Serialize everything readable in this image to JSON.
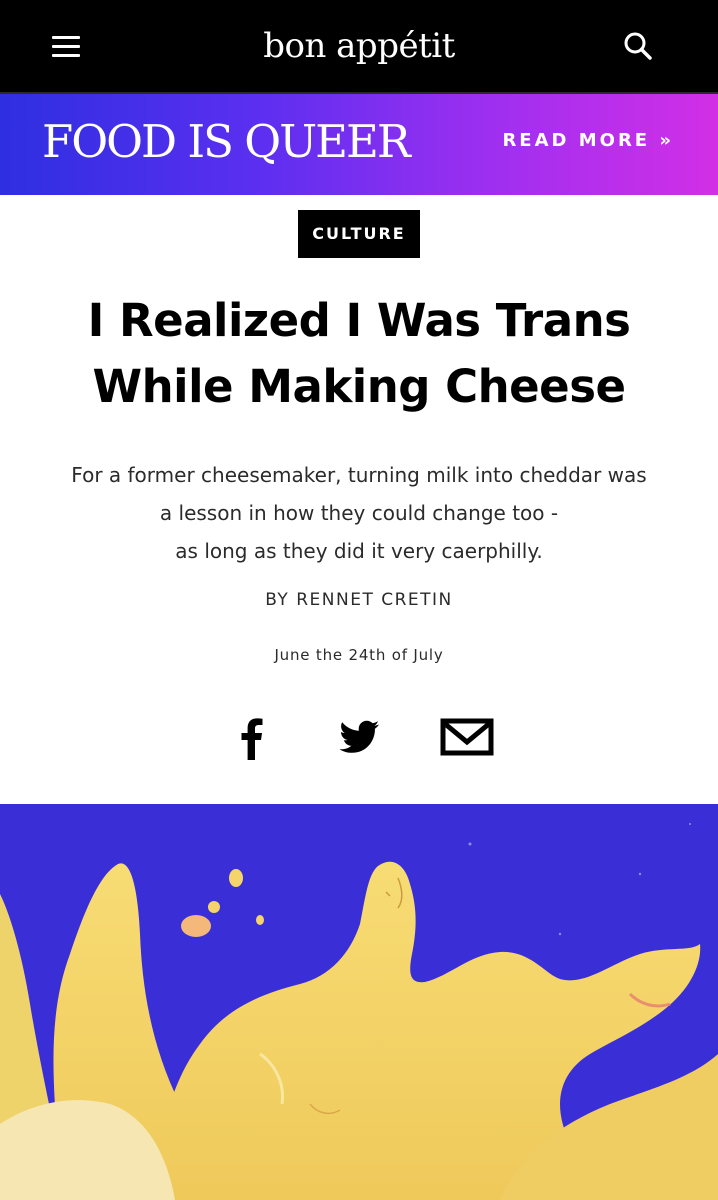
{
  "header": {
    "logo": "bon appétit",
    "menu_icon": "hamburger-menu-icon",
    "search_icon": "search-icon"
  },
  "banner": {
    "title": "FOOD IS QUEER",
    "read_more": "READ MORE »",
    "gradient": [
      "#2e2fe0",
      "#d22fe6"
    ]
  },
  "article": {
    "category": "CULTURE",
    "headline_line1": "I Realized I Was Trans",
    "headline_line2": "While Making Cheese",
    "dek_line1": "For a former cheesemaker, turning milk into cheddar was",
    "dek_line2": "a lesson in how they could change too -",
    "dek_line3": "as long as they did it very caerphilly.",
    "byline": "BY RENNET CRETIN",
    "date": "June the 24th of July"
  },
  "share": {
    "facebook_icon": "facebook-icon",
    "twitter_icon": "twitter-icon",
    "email_icon": "email-icon"
  },
  "hero": {
    "background_color": "#3a2fd6",
    "figure_color": "#f5d56b"
  }
}
